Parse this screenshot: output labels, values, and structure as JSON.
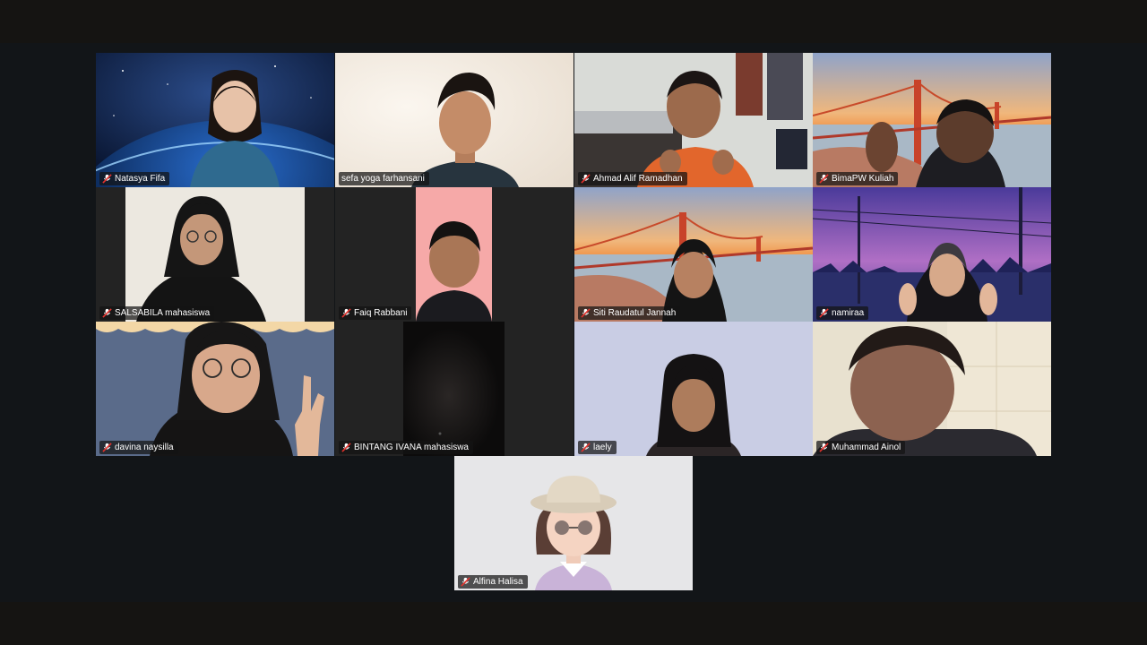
{
  "app": {
    "background": "#121518",
    "active_speaker_color": "#2bd17a",
    "mic_status_icon": "muted-mic-icon"
  },
  "participants": [
    {
      "name": "Natasya Fifa",
      "muted": true,
      "active": false
    },
    {
      "name": "sefa yoga farhansani",
      "muted": false,
      "active": true
    },
    {
      "name": "Ahmad Alif Ramadhan",
      "muted": true,
      "active": false
    },
    {
      "name": "BimaPW Kuliah",
      "muted": true,
      "active": false
    },
    {
      "name": "SALSABILA mahasiswa",
      "muted": true,
      "active": false
    },
    {
      "name": "Faiq Rabbani",
      "muted": true,
      "active": false
    },
    {
      "name": "Siti Raudatul Jannah",
      "muted": true,
      "active": false
    },
    {
      "name": "namiraa",
      "muted": true,
      "active": false
    },
    {
      "name": "davina naysilla",
      "muted": true,
      "active": false
    },
    {
      "name": "BINTANG IVANA mahasiswa",
      "muted": true,
      "active": false
    },
    {
      "name": "laely",
      "muted": true,
      "active": false
    },
    {
      "name": "Muhammad Ainol",
      "muted": true,
      "active": false
    },
    {
      "name": "Alfina Halisa",
      "muted": true,
      "active": false
    }
  ]
}
